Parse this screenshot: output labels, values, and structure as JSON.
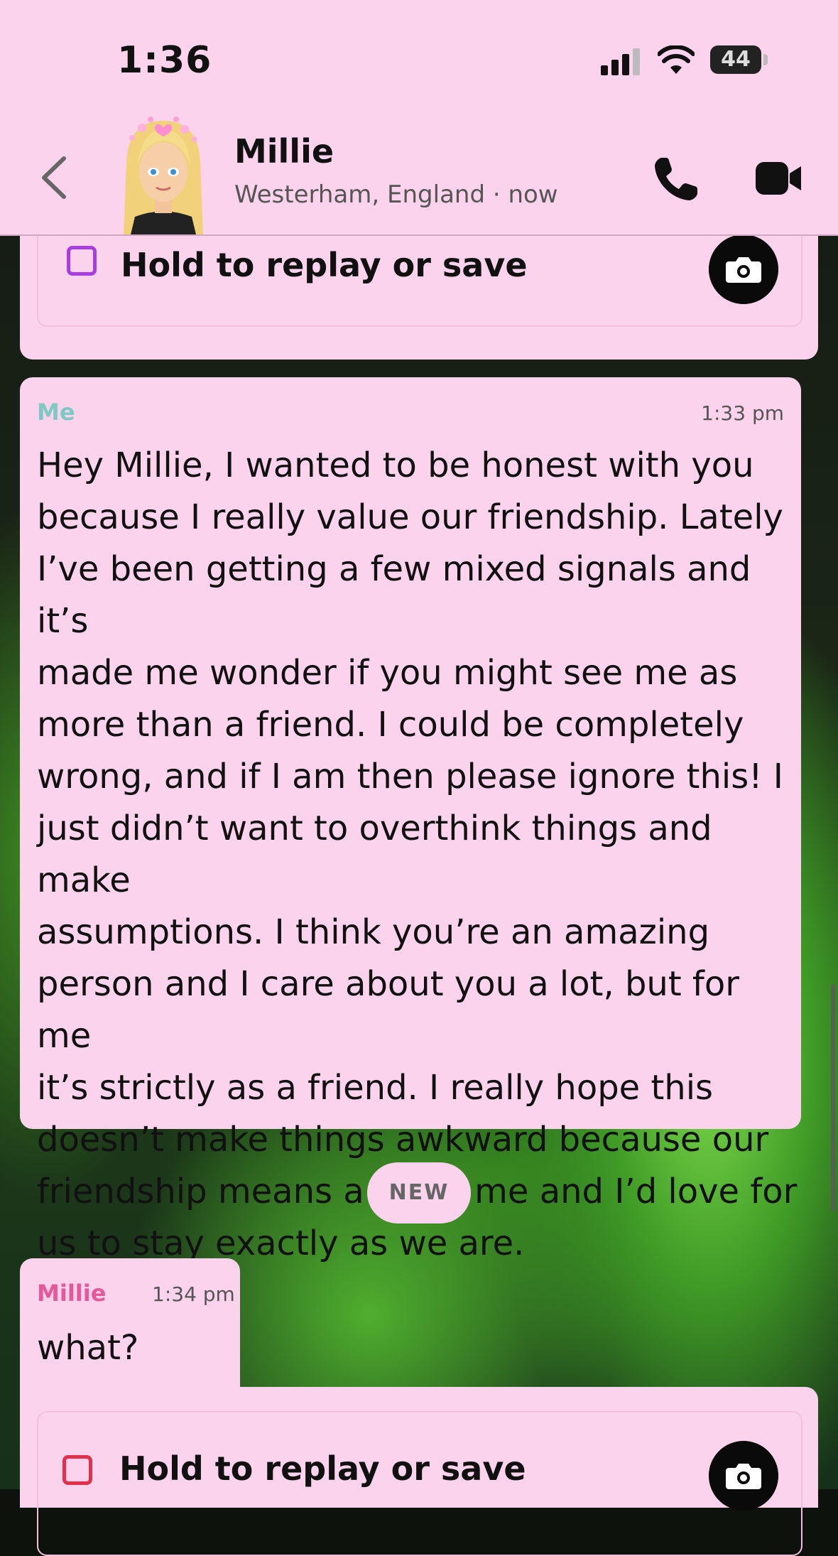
{
  "status_bar": {
    "time": "1:36",
    "battery": "44"
  },
  "header": {
    "contact_name": "Millie",
    "contact_subtitle": "Westerham, England · now"
  },
  "snap_top": {
    "label": "Hold to replay or save",
    "checkbox_color": "#a93ee0"
  },
  "message_me": {
    "sender": "Me",
    "time": "1:33 pm",
    "text": "Hey Millie, I wanted to be honest with you\nbecause I really value our friendship. Lately\nI’ve been getting a few mixed signals and it’s\nmade me wonder if you might see me as\nmore than a friend. I could be completely\nwrong, and if I am then please ignore this! I\njust didn’t want to overthink things and make\nassumptions. I think you’re an amazing\nperson and I care about you a lot, but for me\nit’s strictly as a friend. I really hope this\ndoesn’t make things awkward because our\nfriendship means a lot to me and I’d love for\nus to stay exactly as we are."
  },
  "divider": {
    "label": "NEW"
  },
  "message_millie": {
    "sender": "Millie",
    "time": "1:34 pm",
    "text": "what?"
  },
  "snap_bottom": {
    "label": "Hold to replay or save",
    "checkbox_color": "#e0304a"
  },
  "colors": {
    "bubble": "#fcd3ec",
    "me_name": "#7ec9c4",
    "millie_name": "#e5589a"
  }
}
